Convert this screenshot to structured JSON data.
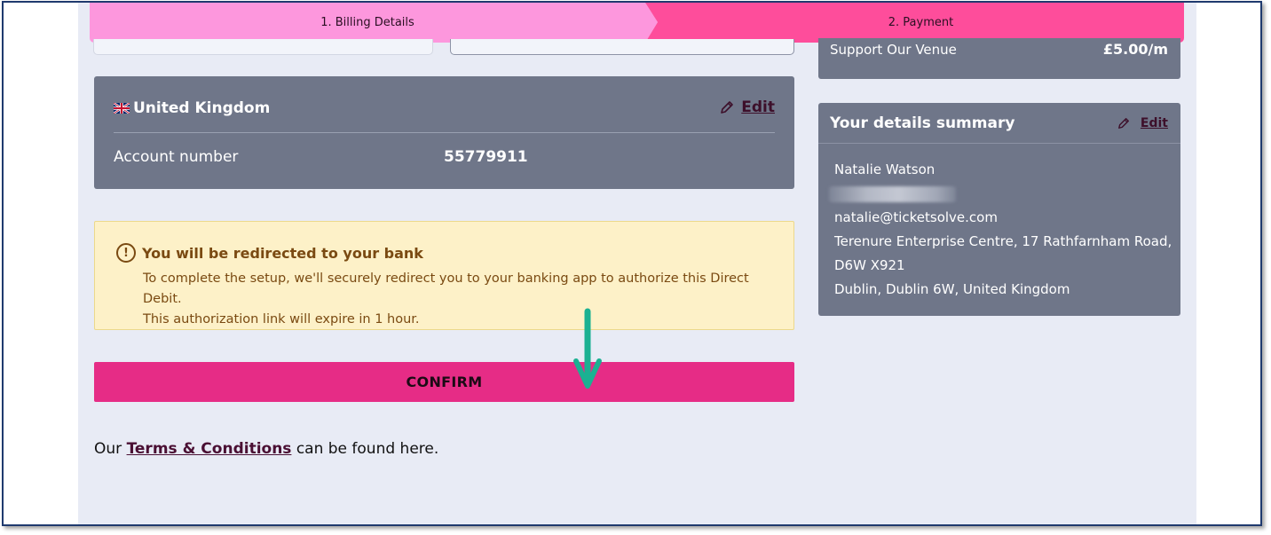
{
  "stepper": {
    "step1": "1. Billing Details",
    "step2": "2. Payment",
    "colors": {
      "step1": "#fd97dd",
      "step2": "#fe4d9b"
    }
  },
  "bank": {
    "country_icon": "uk-flag-icon",
    "country": "United Kingdom",
    "edit_icon": "pencil-icon",
    "edit_label": "Edit",
    "account_label": "Account number",
    "account_number": "55779911"
  },
  "notice": {
    "icon": "exclamation-circle-icon",
    "title": "You will be redirected to your bank",
    "body_line1": "To complete the setup, we'll securely redirect you to your banking app to authorize this Direct Debit.",
    "body_line2": "This authorization link will expire in 1 hour."
  },
  "confirm": {
    "label": "CONFIRM",
    "color": "#e62c86"
  },
  "annotation": {
    "icon": "arrow-down-icon",
    "color": "#1bb192"
  },
  "terms": {
    "prefix": "Our ",
    "link": "Terms & Conditions",
    "suffix": " can be found here."
  },
  "support": {
    "label": "Support Our Venue",
    "value": "£5.00/m"
  },
  "summary": {
    "title": "Your details summary",
    "edit_icon": "pencil-icon",
    "edit_label": "Edit",
    "name": "Natalie Watson",
    "email": "natalie@ticketsolve.com",
    "address_line1": "Terenure Enterprise Centre, 17 Rathfarnham Road,",
    "address_line2": "D6W X921",
    "address_line3": "Dublin, Dublin 6W, United Kingdom"
  },
  "colors": {
    "card": "#6f7689",
    "background": "#e8ebf5",
    "notice": "#fdf1c8"
  }
}
